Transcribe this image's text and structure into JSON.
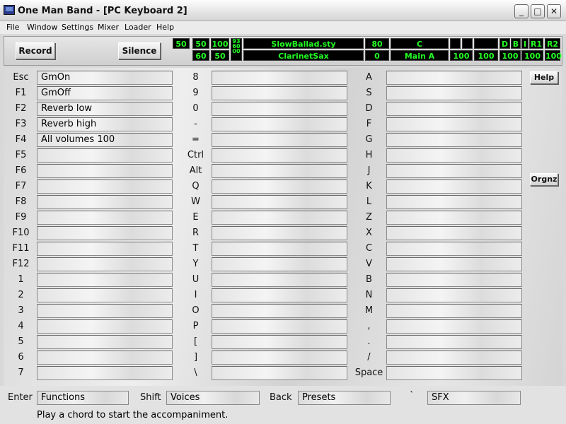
{
  "window": {
    "title": "One Man Band - [PC Keyboard 2]",
    "minimize": "_",
    "maximize": "□",
    "close": "✕"
  },
  "menu": [
    "File",
    "Window",
    "Settings",
    "Mixer",
    "Loader",
    "Help"
  ],
  "toolbar": {
    "record_label": "Record",
    "silence_label": "Silence"
  },
  "lcd": {
    "row1": {
      "v1": "50",
      "v2": "50",
      "v3": "100",
      "stack": [
        "93",
        "60",
        "00"
      ],
      "style": "SlowBallad.sty",
      "tempo": "80",
      "key": "C",
      "flags": [
        "",
        "",
        "",
        "D",
        "B",
        "I",
        "R1",
        "R2"
      ]
    },
    "row2": {
      "v2": "60",
      "v3": "50",
      "voice": "ClarinetSax",
      "num": "0",
      "section": "Main A",
      "vols": [
        "100",
        "100",
        "100",
        "100",
        "100"
      ]
    }
  },
  "columns": [
    {
      "keys": [
        {
          "key": "Esc",
          "value": "GmOn"
        },
        {
          "key": "F1",
          "value": "GmOff"
        },
        {
          "key": "F2",
          "value": "Reverb low"
        },
        {
          "key": "F3",
          "value": "Reverb high"
        },
        {
          "key": "F4",
          "value": "All volumes 100"
        },
        {
          "key": "F5",
          "value": ""
        },
        {
          "key": "F6",
          "value": ""
        },
        {
          "key": "F7",
          "value": ""
        },
        {
          "key": "F8",
          "value": ""
        },
        {
          "key": "F9",
          "value": ""
        },
        {
          "key": "F10",
          "value": ""
        },
        {
          "key": "F11",
          "value": ""
        },
        {
          "key": "F12",
          "value": ""
        },
        {
          "key": "1",
          "value": ""
        },
        {
          "key": "2",
          "value": ""
        },
        {
          "key": "3",
          "value": ""
        },
        {
          "key": "4",
          "value": ""
        },
        {
          "key": "5",
          "value": ""
        },
        {
          "key": "6",
          "value": ""
        },
        {
          "key": "7",
          "value": ""
        }
      ]
    },
    {
      "keys": [
        {
          "key": "8",
          "value": ""
        },
        {
          "key": "9",
          "value": ""
        },
        {
          "key": "0",
          "value": ""
        },
        {
          "key": "-",
          "value": ""
        },
        {
          "key": "=",
          "value": ""
        },
        {
          "key": "Ctrl",
          "value": ""
        },
        {
          "key": "Alt",
          "value": ""
        },
        {
          "key": "Q",
          "value": ""
        },
        {
          "key": "W",
          "value": ""
        },
        {
          "key": "E",
          "value": ""
        },
        {
          "key": "R",
          "value": ""
        },
        {
          "key": "T",
          "value": ""
        },
        {
          "key": "Y",
          "value": ""
        },
        {
          "key": "U",
          "value": ""
        },
        {
          "key": "I",
          "value": ""
        },
        {
          "key": "O",
          "value": ""
        },
        {
          "key": "P",
          "value": ""
        },
        {
          "key": "[",
          "value": ""
        },
        {
          "key": "]",
          "value": ""
        },
        {
          "key": "\\",
          "value": ""
        }
      ]
    },
    {
      "keys": [
        {
          "key": "A",
          "value": ""
        },
        {
          "key": "S",
          "value": ""
        },
        {
          "key": "D",
          "value": ""
        },
        {
          "key": "F",
          "value": ""
        },
        {
          "key": "G",
          "value": ""
        },
        {
          "key": "H",
          "value": ""
        },
        {
          "key": "J",
          "value": ""
        },
        {
          "key": "K",
          "value": ""
        },
        {
          "key": "L",
          "value": ""
        },
        {
          "key": "Z",
          "value": ""
        },
        {
          "key": "X",
          "value": ""
        },
        {
          "key": "C",
          "value": ""
        },
        {
          "key": "V",
          "value": ""
        },
        {
          "key": "B",
          "value": ""
        },
        {
          "key": "N",
          "value": ""
        },
        {
          "key": "M",
          "value": ""
        },
        {
          "key": ",",
          "value": ""
        },
        {
          "key": ".",
          "value": ""
        },
        {
          "key": "/",
          "value": ""
        },
        {
          "key": "Space",
          "value": ""
        }
      ]
    }
  ],
  "side_buttons": {
    "help_label": "Help",
    "orgnz_label": "Orgnz"
  },
  "bottom": {
    "enter_label": "Enter",
    "enter_value": "Functions",
    "shift_label": "Shift",
    "shift_value": "Voices",
    "back_label": "Back",
    "back_value": "Presets",
    "tick_label": "`",
    "tick_value": "SFX",
    "status": "Play a chord to start the accompaniment."
  }
}
